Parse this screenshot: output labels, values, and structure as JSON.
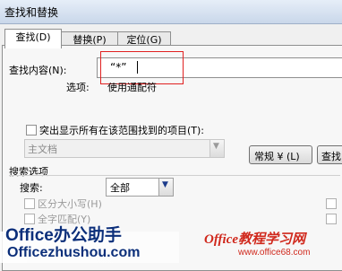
{
  "window": {
    "title": "查找和替换"
  },
  "tabs": [
    {
      "label": "查找(D)"
    },
    {
      "label": "替换(P)"
    },
    {
      "label": "定位(G)"
    }
  ],
  "find": {
    "label": "查找内容(N):",
    "value": "“*”",
    "options_label": "选项:",
    "options_value": "使用通配符"
  },
  "highlight": {
    "label": "突出显示所有在该范围找到的项目(T):",
    "scope_value": "主文档"
  },
  "buttons": {
    "normal": "常规 ¥ (L)",
    "find": "查找"
  },
  "search_options": {
    "group_label": "搜索选项",
    "search_label": "搜索:",
    "search_value": "全部",
    "match_case": "区分大小写(H)",
    "whole_word": "全字匹配(Y)"
  },
  "watermark": {
    "left_text": "Office办公助手",
    "left_url": "Officezhushou.com",
    "right_text": "Office教程学习网",
    "right_url": "www.office68.com"
  },
  "colors": {
    "highlight_box": "#e02020",
    "watermark_blue": "#0c2f7a",
    "watermark_red": "#d0281c"
  }
}
